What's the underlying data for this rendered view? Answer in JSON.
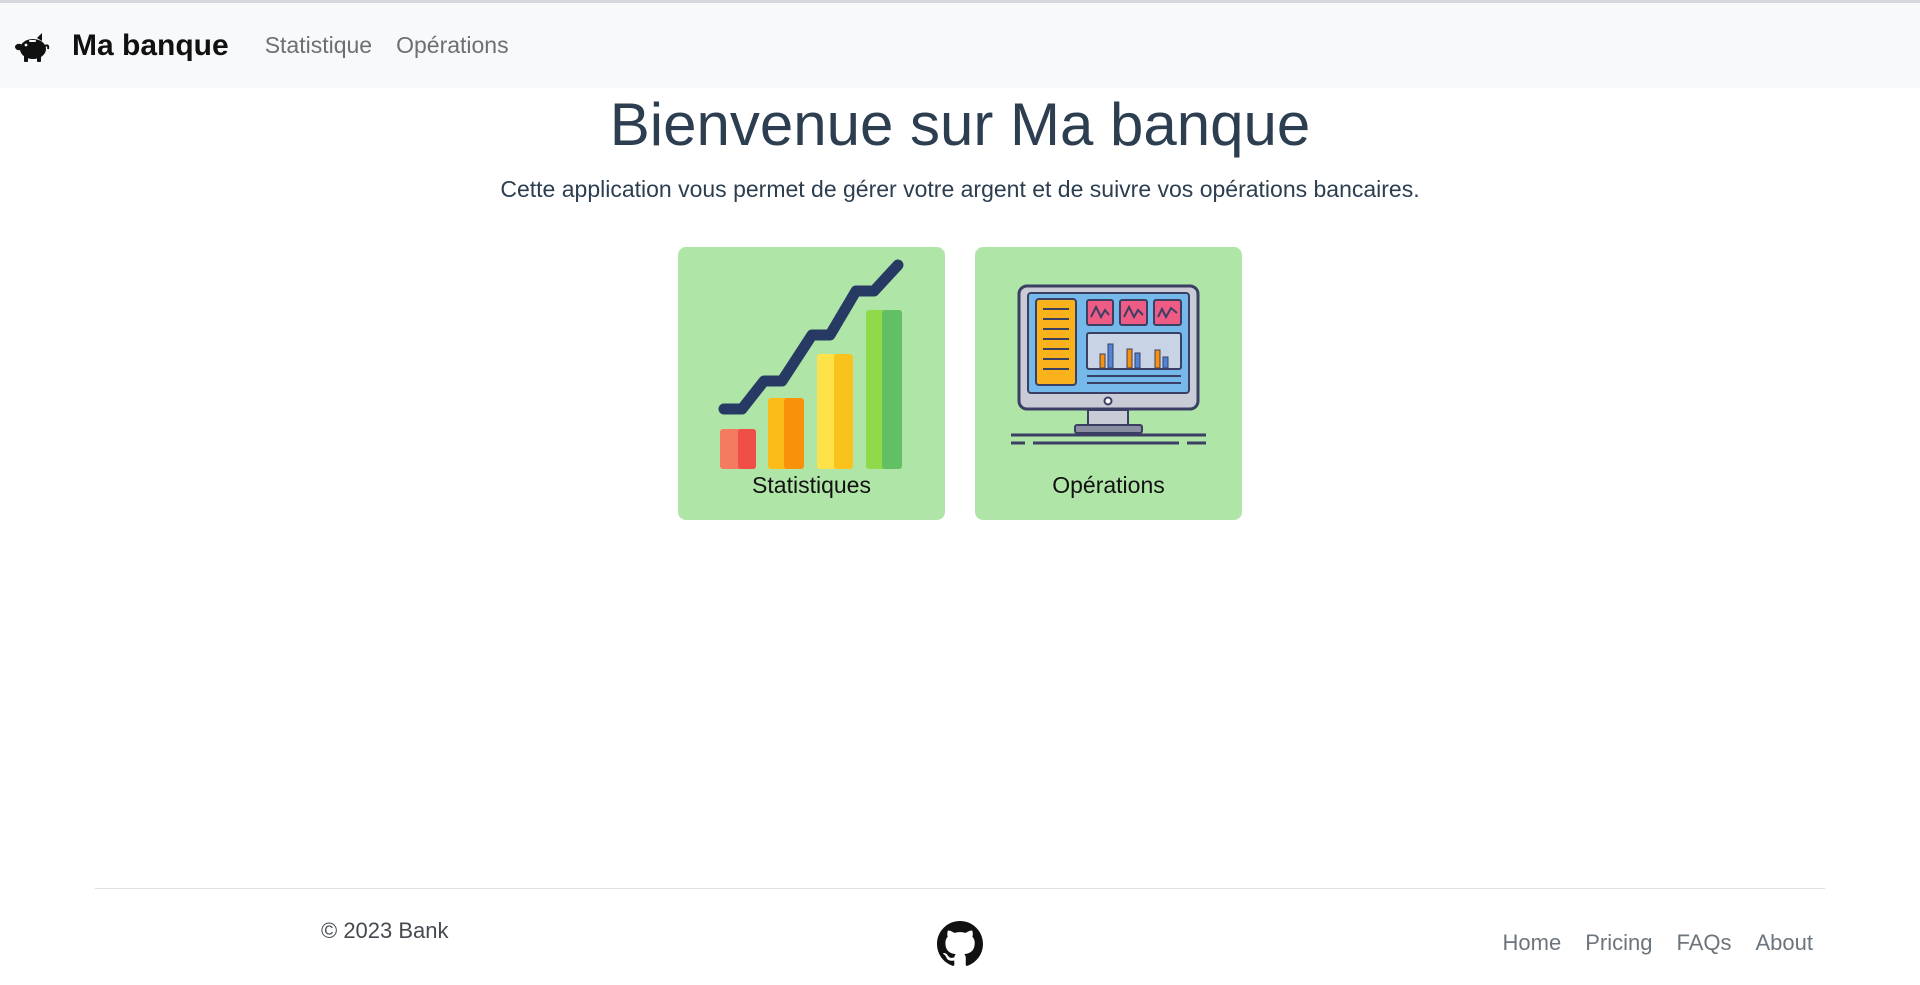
{
  "navbar": {
    "brand_icon": "piggy-bank-icon",
    "brand": "Ma banque",
    "links": [
      "Statistique",
      "Opérations"
    ]
  },
  "hero": {
    "title": "Bienvenue sur Ma banque",
    "subtitle": "Cette application vous permet de gérer votre argent et de suivre vos opérations bancaires."
  },
  "cards": [
    {
      "label": "Statistiques",
      "icon": "growth-bar-chart-icon"
    },
    {
      "label": "Opérations",
      "icon": "monitor-dashboard-icon"
    }
  ],
  "footer": {
    "copyright": "© 2023 Bank",
    "github_icon": "github-icon",
    "links": [
      "Home",
      "Pricing",
      "FAQs",
      "About"
    ]
  },
  "colors": {
    "card_background": "#b0e5a8",
    "title_text": "#2c3e50",
    "navbar_background": "#f8f9fa"
  }
}
